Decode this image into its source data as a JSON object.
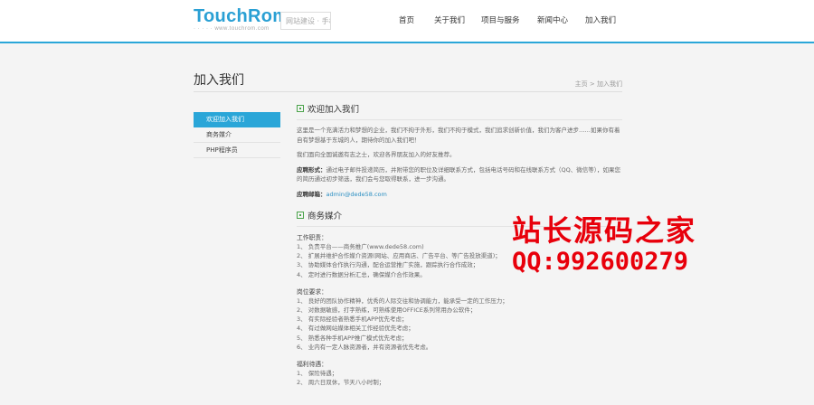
{
  "header": {
    "logo_text": "TouchRom",
    "logo_sub": "· · · · ·  www.touchrom.com",
    "search_placeholder": "网站建设 · 手机",
    "nav": [
      {
        "label": "首页"
      },
      {
        "label": "关于我们"
      },
      {
        "label": "项目与服务"
      },
      {
        "label": "新闻中心"
      },
      {
        "label": "加入我们"
      }
    ],
    "colors": {
      "accent": "#2aa6d8",
      "brand": "#2aa0d4"
    }
  },
  "page": {
    "title": "加入我们",
    "breadcrumb": "主页 > 加入我们"
  },
  "sidebar": {
    "items": [
      {
        "label": "欢迎加入我们",
        "active": true
      },
      {
        "label": "商务媒介",
        "active": false
      },
      {
        "label": "PHP程序员",
        "active": false
      }
    ]
  },
  "main": {
    "section1": {
      "title": "欢迎加入我们",
      "p1": "这里是一个充满活力和梦想的企业，我们不拘于外形，我们不拘于模式，我们追求创新价值，我们为客户进步……如果你有着自有梦想基于东城的人，期待你的加入我们吧！",
      "p2": "我们面向全国诚邀有志之士，欢迎各界朋友加入的好友推荐。",
      "apply_label": "应聘形式：",
      "apply_text": "通过电子邮件投递简历，并附带您的职位及详细联系方式，包括电话号码和在线联系方式（QQ、微信等），如果您的简历通过初步筛选，我们会与您取得联系，进一步沟通。",
      "email_label": "应聘邮箱：",
      "email": "admin@dede58.com"
    },
    "section2": {
      "title": "商务媒介",
      "duties_title": "工作职责：",
      "duties": [
        "1、 负责平台——商务推广(www.dede58.com)",
        "2、 扩展并维护合作媒介资源(网站、应用商店、广告平台、等广告投放渠道)；",
        "3、 协助媒体合作执行沟通，配合运营推广实施，跟踪执行合作成效；",
        "4、 定时进行数据分析汇总，确保媒介合作效果。"
      ],
      "req_title": "岗位要求：",
      "requirements": [
        "1、 良好的团队协作精神，优秀的人际交往和协调能力，能承受一定的工作压力；",
        "2、 对数据敏感，打字熟练，可熟练使用OFFICE系列常用办公软件；",
        "3、 有实际经验者熟悉手机APP优先考虑；",
        "4、 有过做网站媒体相关工作经验优先考虑；",
        "5、 熟悉各种手机APP推广模式优先考虑；",
        "6、 业内有一定人脉资源者，并有资源者优先考虑。"
      ],
      "benefits_title": "福利待遇：",
      "benefits": [
        "1、 保险待遇；",
        "2、 周六日双休，节天八小时制；"
      ]
    }
  },
  "watermark": {
    "line1": "站长源码之家",
    "line2": "QQ:992600279",
    "color": "#e8000b"
  }
}
